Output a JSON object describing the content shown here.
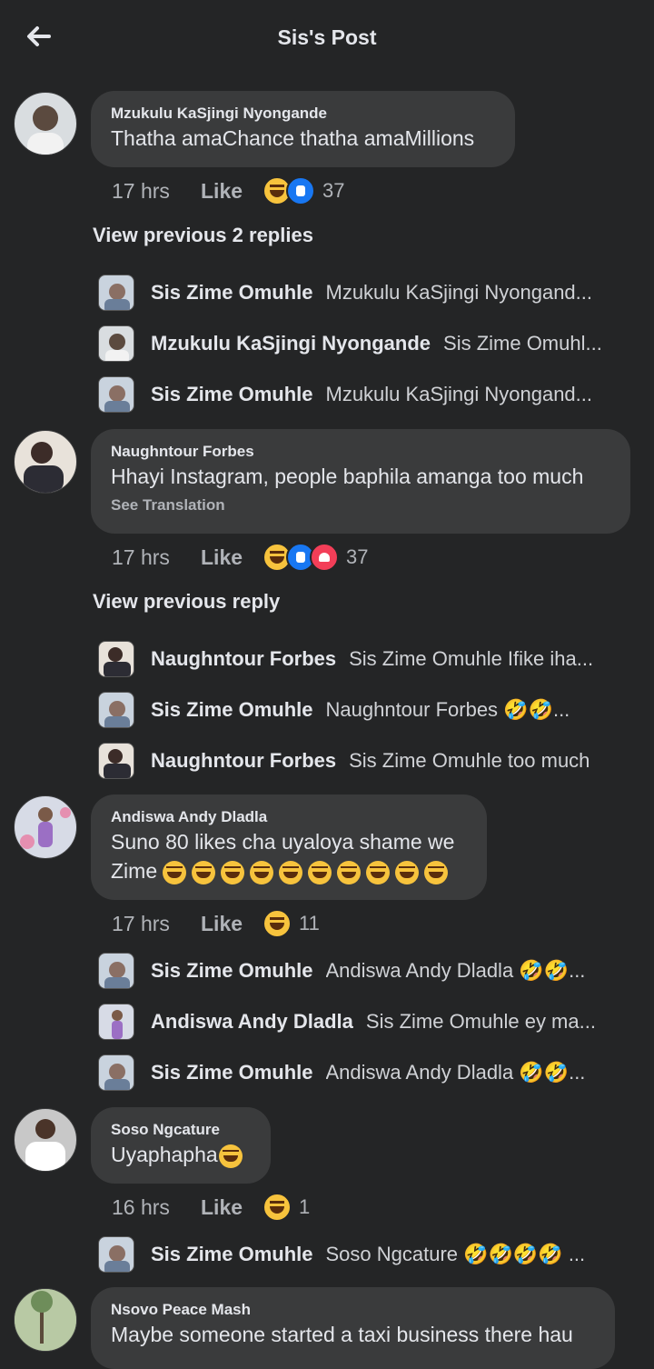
{
  "header": {
    "title": "Sis's Post",
    "back_icon": "arrow-left-icon"
  },
  "comments": [
    {
      "author": "Mzukulu KaSjingi Nyongande",
      "text": "Thatha amaChance thatha amaMillions",
      "time": "17 hrs",
      "like_label": "Like",
      "reactions": [
        "haha",
        "like"
      ],
      "reaction_count": "37",
      "view_previous": "View previous 2 replies",
      "replies": [
        {
          "name": "Sis Zime Omuhle",
          "text": "Mzukulu KaSjingi Nyongand..."
        },
        {
          "name": "Mzukulu KaSjingi Nyongande",
          "text": "Sis Zime Omuhl..."
        },
        {
          "name": "Sis Zime Omuhle",
          "text": "Mzukulu KaSjingi Nyongand..."
        }
      ]
    },
    {
      "author": "Naughntour Forbes",
      "text": "Hhayi Instagram, people baphila amanga too much",
      "see_translation": "See Translation",
      "time": "17 hrs",
      "like_label": "Like",
      "reactions": [
        "haha",
        "like",
        "love"
      ],
      "reaction_count": "37",
      "view_previous": "View previous reply",
      "replies": [
        {
          "name": "Naughntour Forbes",
          "text": "Sis Zime Omuhle Ifike iha..."
        },
        {
          "name": "Sis Zime Omuhle",
          "text": "Naughntour Forbes 🤣🤣..."
        },
        {
          "name": "Naughntour Forbes",
          "text": "Sis Zime Omuhle too much"
        }
      ]
    },
    {
      "author": "Andiswa Andy Dladla",
      "text_line1": "Suno 80 likes cha uyaloya shame we",
      "text_line2": "Zime",
      "trailing_emoji_count": 10,
      "time": "17 hrs",
      "like_label": "Like",
      "reactions": [
        "haha"
      ],
      "reaction_count": "11",
      "replies": [
        {
          "name": "Sis Zime Omuhle",
          "text": "Andiswa Andy Dladla 🤣🤣..."
        },
        {
          "name": "Andiswa Andy Dladla",
          "text": "Sis Zime Omuhle  ey ma..."
        },
        {
          "name": "Sis Zime Omuhle",
          "text": "Andiswa Andy Dladla 🤣🤣..."
        }
      ]
    },
    {
      "author": "Soso Ngcature",
      "text": "Uyaphapha",
      "time": "16 hrs",
      "like_label": "Like",
      "reactions": [
        "haha"
      ],
      "reaction_count": "1",
      "replies": [
        {
          "name": "Sis Zime Omuhle",
          "text": "Soso Ngcature 🤣🤣🤣🤣 ..."
        }
      ]
    },
    {
      "author": "Nsovo Peace Mash",
      "text": "Maybe someone started a taxi business there hau"
    }
  ]
}
